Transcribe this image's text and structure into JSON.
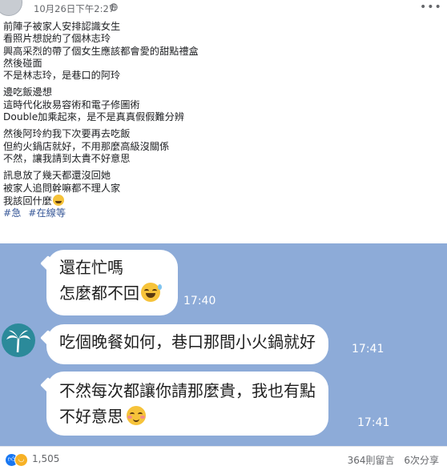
{
  "post": {
    "timestamp": "10月26日下午2:27",
    "paragraphs": [
      [
        "前陣子被家人安排認識女生",
        "看照片想說約了個林志玲",
        "興高采烈的帶了個女生應該都會愛的甜點禮盒",
        "然後碰面",
        "不是林志玲，是巷口的阿玲"
      ],
      [
        "邊吃飯邊想",
        "這時代化妝易容術和電子修圖術",
        "Double加乘起來，是不是真真假假難分辨"
      ],
      [
        "然後阿玲約我下次要再去吃飯",
        "但約火鍋店就好，不用那麼高級沒關係",
        "不然，讓我請到太貴不好意思"
      ],
      [
        "訊息放了幾天都還沒回她",
        "被家人追問幹嘛都不理人家",
        "我該回什麼"
      ]
    ],
    "hashtags": [
      "#急",
      "#在線等"
    ],
    "face_emoji": "grinning-face-emoji"
  },
  "chat": {
    "background": "#8dabd8",
    "messages": [
      {
        "lines": [
          "還在忙嗎",
          "怎麼都不回"
        ],
        "time": "17:40",
        "emoji": "grinning-sweat-emoji"
      },
      {
        "lines": [
          "吃個晚餐如何，巷口那間小火鍋就好"
        ],
        "time": "17:41",
        "avatar_icon": "palm-tree-icon"
      },
      {
        "lines": [
          "不然每次都讓你請那麼貴，我也有點",
          "不好意思"
        ],
        "time": "17:41",
        "emoji": "blushing-face-emoji"
      }
    ]
  },
  "footer": {
    "reaction_count": "1,505",
    "comments": "364則留言",
    "shares": "6次分享",
    "reaction_icons": [
      "like-reaction-icon",
      "haha-reaction-icon"
    ]
  }
}
